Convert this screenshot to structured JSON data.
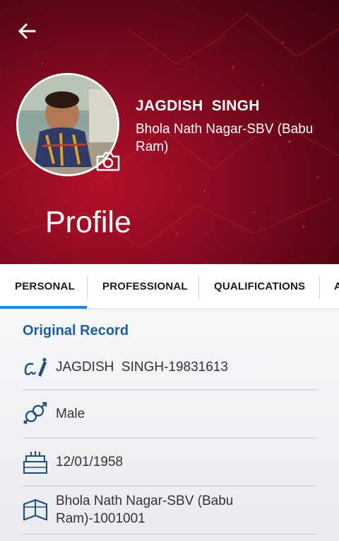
{
  "header": {
    "name": "JAGDISH  SINGH",
    "location": "Bhola Nath Nagar-SBV (Babu Ram)",
    "page_title": "Profile"
  },
  "tabs": [
    {
      "label": "PERSONAL",
      "active": true
    },
    {
      "label": "PROFESSIONAL",
      "active": false
    },
    {
      "label": "QUALIFICATIONS",
      "active": false
    },
    {
      "label": "A",
      "active": false
    }
  ],
  "section": {
    "title": "Original Record",
    "rows": [
      {
        "icon": "signature-icon",
        "text": "JAGDISH  SINGH-19831613"
      },
      {
        "icon": "gender-icon",
        "text": "Male"
      },
      {
        "icon": "birthday-cake-icon",
        "text": "12/01/1958"
      },
      {
        "icon": "book-icon",
        "text": "Bhola Nath Nagar-SBV (Babu Ram)-1001001"
      }
    ]
  },
  "colors": {
    "header_red": "#8a0b22",
    "tab_accent": "#1e8be0",
    "section_title": "#1f5d9c",
    "icon_blue": "#1f4e7a"
  }
}
